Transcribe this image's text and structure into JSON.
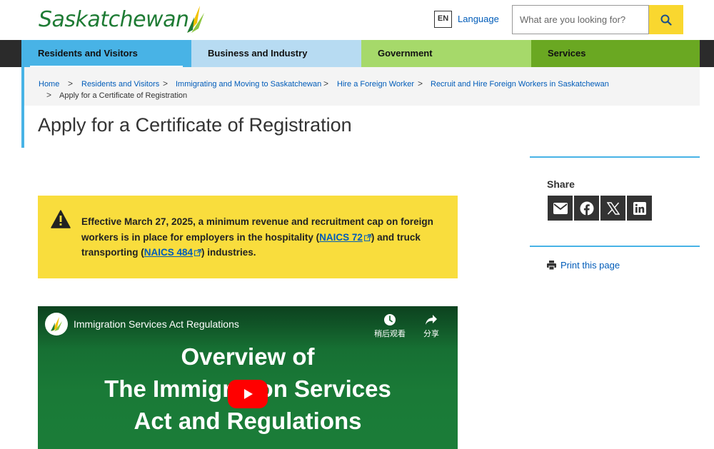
{
  "header": {
    "logo_text": "Saskatchewan",
    "lang_code": "EN",
    "lang_label": "Language",
    "search_placeholder": "What are you looking for?"
  },
  "nav": {
    "items": [
      {
        "label": "Residents and Visitors",
        "color": "#48b3e6"
      },
      {
        "label": "Business and Industry",
        "color": "#b7dbf2"
      },
      {
        "label": "Government",
        "color": "#a6d96a"
      },
      {
        "label": "Services",
        "color": "#6aa822"
      }
    ]
  },
  "breadcrumb": {
    "items": [
      "Home",
      "Residents and Visitors",
      "Immigrating and Moving to Saskatchewan",
      "Hire a Foreign Worker",
      "Recruit and Hire Foreign Workers in Saskatchewan"
    ],
    "current": "Apply for a Certificate of Registration",
    "separator": ">"
  },
  "page": {
    "title": "Apply for a Certificate of Registration"
  },
  "alert": {
    "text_1": "Effective March 27, 2025, a minimum revenue and recruitment cap on foreign workers is in place for employers in the hospitality (",
    "link_1": "NAICS 72",
    "text_2": ") and truck transporting (",
    "link_2": "NAICS 484",
    "text_3": ") industries.",
    "color": "#f9dd3d"
  },
  "video": {
    "title": "Immigration Services Act Regulations",
    "watch_later": "稍后观看",
    "share": "分享",
    "overlay_lines": [
      "Overview of",
      "The Immigration Services",
      "Act and Regulations"
    ]
  },
  "sidebar": {
    "share_label": "Share",
    "share_buttons": [
      "email-icon",
      "facebook-icon",
      "x-icon",
      "linkedin-icon"
    ],
    "print_label": "Print this page"
  }
}
